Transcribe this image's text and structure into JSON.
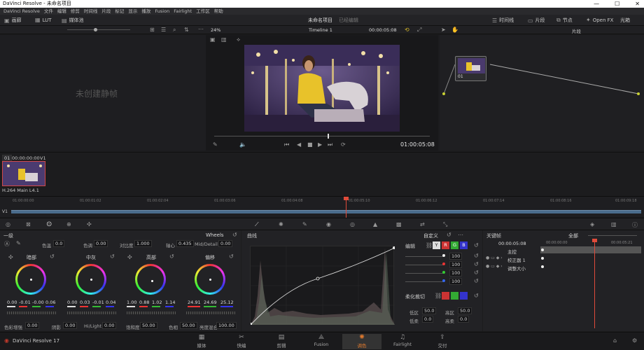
{
  "window": {
    "title": "DaVinci Resolve - 未命名项目",
    "min": "—",
    "max": "☐",
    "close": "✕"
  },
  "menu": [
    "DaVinci Resolve",
    "文件",
    "编辑",
    "修剪",
    "时间线",
    "片段",
    "标记",
    "显示",
    "播放",
    "Fusion",
    "Fairlight",
    "工作区",
    "帮助"
  ],
  "topbar": {
    "gallery": "画廊",
    "lut": "LUT",
    "media_pool": "媒体池",
    "project_title": "未命名项目",
    "project_status": "已经编辑",
    "timeline_btn": "时间线",
    "clips_btn": "片段",
    "nodes_btn": "节点",
    "openfx_btn": "Open FX",
    "lightbox_btn": "光箱"
  },
  "viewer": {
    "zoom": "24%",
    "timeline_name": "Timeline 1",
    "timecode_top": "00:00:05:08",
    "clip_mode": "片段",
    "timecode": "01:00:05:08",
    "empty_still": "未创建静帧"
  },
  "clips": {
    "index": "01",
    "timecode": "00:00:00:00",
    "track": "V1",
    "codec": "H.264 Main L4.1"
  },
  "timeline": {
    "track": "V1",
    "ticks": [
      "01:00:00:00",
      "01:00:01:02",
      "01:00:02:04",
      "01:00:03:06",
      "01:00:04:08",
      "01:00:05:10",
      "01:00:06:12",
      "01:00:07:14",
      "01:00:08:16",
      "01:00:09:18"
    ]
  },
  "node": {
    "label": "01"
  },
  "wheels": {
    "title": "一级",
    "mode": "Wheels",
    "top_controls": [
      {
        "label": "色温",
        "value": "0.0"
      },
      {
        "label": "色调",
        "value": "0.00"
      },
      {
        "label": "对比度",
        "value": "1.000"
      },
      {
        "label": "轴心",
        "value": "0.435"
      },
      {
        "label": "Mid/Detail",
        "value": "0.00"
      }
    ],
    "items": [
      {
        "name": "暗部",
        "values": [
          "0.00",
          "-0.01",
          "-0.00",
          "0.06"
        ]
      },
      {
        "name": "中灰",
        "values": [
          "0.00",
          "0.03",
          "-0.01",
          "0.04"
        ]
      },
      {
        "name": "高部",
        "values": [
          "1.00",
          "0.88",
          "1.02",
          "1.14"
        ]
      },
      {
        "name": "偏移",
        "values": [
          "24.91",
          "24.69",
          "25.12",
          ""
        ]
      }
    ],
    "bottom_controls": [
      {
        "label": "色彩增强",
        "value": "0.00"
      },
      {
        "label": "阴影",
        "value": "0.00"
      },
      {
        "label": "Hi/Light",
        "value": "0.00"
      },
      {
        "label": "饱和度",
        "value": "50.00"
      },
      {
        "label": "色相",
        "value": "50.00"
      },
      {
        "label": "亮度混合",
        "value": "100.00"
      }
    ]
  },
  "curves": {
    "title": "曲线",
    "mode": "自定义",
    "edit_label": "编辑",
    "channels": [
      "Y",
      "R",
      "G",
      "B"
    ],
    "channel_values": [
      "100",
      "100",
      "100",
      "100"
    ],
    "soft_clip_label": "柔化裁切",
    "soft": [
      {
        "label": "低区",
        "value": "50.0"
      },
      {
        "label": "高区",
        "value": "50.0"
      },
      {
        "label": "低柔",
        "value": "0.0"
      },
      {
        "label": "高柔",
        "value": "0.0"
      }
    ]
  },
  "keyframes": {
    "title": "关键帧",
    "filter": "全部",
    "timecode": "00:00:05:08",
    "ruler": [
      "00:00:00:00",
      "00:00:05:21"
    ],
    "rows": [
      "主控",
      "校正器 1",
      "调整大小"
    ]
  },
  "bottombar": {
    "app_name": "DaVinci Resolve 17",
    "tabs": [
      "媒体",
      "快编",
      "剪辑",
      "Fusion",
      "调色",
      "Fairlight",
      "交付"
    ],
    "active_tab": 4
  }
}
